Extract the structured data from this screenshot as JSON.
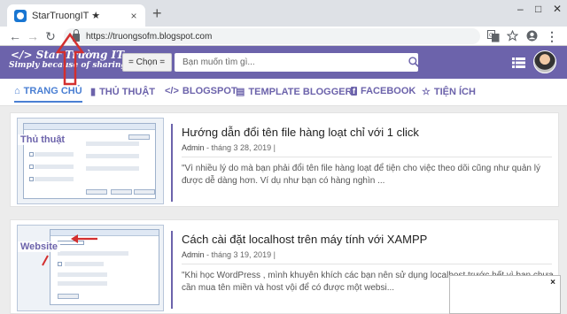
{
  "browser": {
    "tab_title": "StarTruongIT ★",
    "tab_close": "×",
    "new_tab": "+",
    "url": "https://truongsofm.blogspot.com",
    "window_controls": {
      "minimize": "–",
      "maximize": "□",
      "close": "✕"
    }
  },
  "header": {
    "logo_title": "</> Star Trường IT",
    "logo_subtitle": "Simply because of sharing",
    "category_select": "= Chọn =",
    "search_placeholder": "Bạn muốn tìm gì...",
    "bg_color": "#6c63ab"
  },
  "nav": {
    "items": [
      {
        "label": "TRANG CHỦ",
        "icon": "home-icon",
        "active": true
      },
      {
        "label": "THỦ THUẬT",
        "icon": "book-icon"
      },
      {
        "label": "BLOGSPOT",
        "icon": "code-icon"
      },
      {
        "label": "TEMPLATE BLOGGER",
        "icon": "file-icon"
      },
      {
        "label": "FACEBOOK",
        "icon": "facebook-icon"
      },
      {
        "label": "TIỆN ÍCH",
        "icon": "star-icon"
      }
    ]
  },
  "posts": [
    {
      "thumb_label": "Thủ thuật",
      "title": "Hướng dẫn đổi tên file hàng loạt chỉ với 1 click",
      "author": "Admin",
      "date": " - tháng 3 28, 2019 |",
      "snippet": "\"Vì nhiều lý do mà bạn phải đổi tên file hàng loạt để tiện cho việc theo dõi cũng như quản lý được dễ dàng hơn. Ví dụ như bạn có hàng nghìn ..."
    },
    {
      "thumb_label": "Website",
      "title": "Cách cài đặt localhost trên máy tính với XAMPP",
      "author": "Admin",
      "date": " - tháng 3 19, 2019 |",
      "snippet": "\"Khi  học WordPress , mình khuyên khích các bạn nên sử dụng localhost trước hết vì bạn chưa cần mua tên miền và host vội để có được một websi..."
    }
  ],
  "popup": {
    "close": "×"
  }
}
